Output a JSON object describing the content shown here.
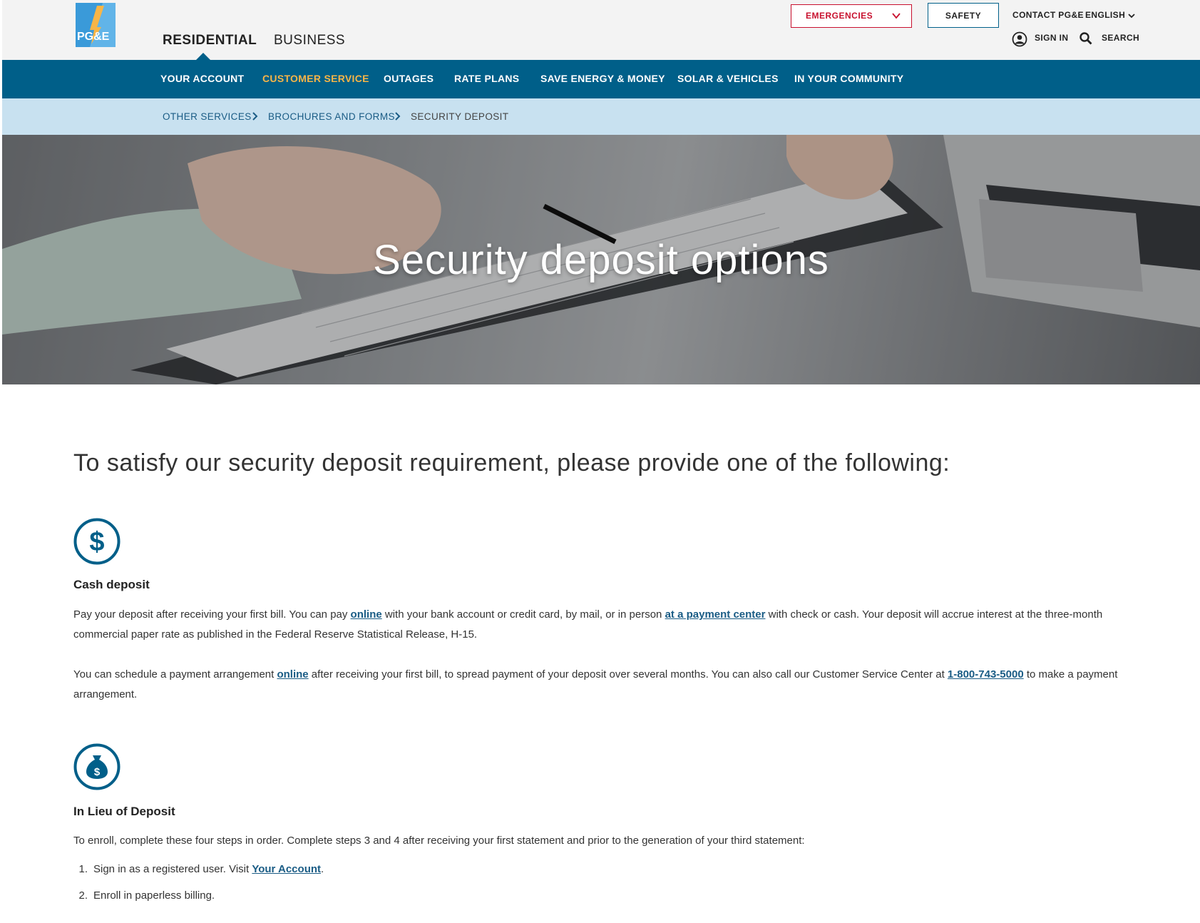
{
  "header": {
    "segments": [
      "RESIDENTIAL",
      "BUSINESS"
    ],
    "emergencies_label": "EMERGENCIES",
    "safety_label": "SAFETY",
    "contact_label": "CONTACT PG&E",
    "language_label": "ENGLISH",
    "signin_label": "SIGN IN",
    "search_label": "SEARCH"
  },
  "nav": {
    "items": [
      "YOUR ACCOUNT",
      "CUSTOMER SERVICE",
      "OUTAGES",
      "RATE PLANS",
      "SAVE ENERGY & MONEY",
      "SOLAR & VEHICLES",
      "IN YOUR COMMUNITY"
    ],
    "active_index": 1
  },
  "breadcrumb": {
    "items": [
      "OTHER SERVICES",
      "BROCHURES AND FORMS",
      "SECURITY DEPOSIT"
    ]
  },
  "hero": {
    "title": "Security deposit options"
  },
  "main": {
    "lead": "To satisfy our security deposit requirement, please provide one of the following:",
    "cash": {
      "icon": "dollar-icon",
      "title": "Cash deposit",
      "p1_a": "Pay your deposit after receiving your first bill. You can pay ",
      "p1_link1": "online",
      "p1_b": " with your bank account or credit card, by mail, or in person ",
      "p1_link2": "at a payment center",
      "p1_c": " with check or cash. Your deposit will accrue interest at the three-month commercial paper rate as published in the Federal Reserve Statistical Release, H-15.",
      "p2_a": "You can schedule a payment arrangement ",
      "p2_link1": "online",
      "p2_b": " after receiving your first bill, to spread payment of your deposit over several months. You can also call our Customer Service Center at ",
      "p2_link2": "1-800-743-5000",
      "p2_c": " to make a payment arrangement."
    },
    "lieu": {
      "icon": "money-bag-icon",
      "title": "In Lieu of Deposit",
      "intro": "To enroll, complete these four steps in order. Complete steps 3 and 4 after receiving your first statement and prior to the generation of your third statement:",
      "step1_num": "1.",
      "step1_a": "Sign in as a registered user. Visit ",
      "step1_link": "Your Account",
      "step1_b": ".",
      "step2_num": "2.",
      "step2": "Enroll in paperless billing."
    }
  },
  "colors": {
    "brand_blue": "#005f89",
    "active_nav": "#f7b547",
    "emergency_red": "#c8102e",
    "breadcrumb_bg": "#c8e1f0"
  }
}
